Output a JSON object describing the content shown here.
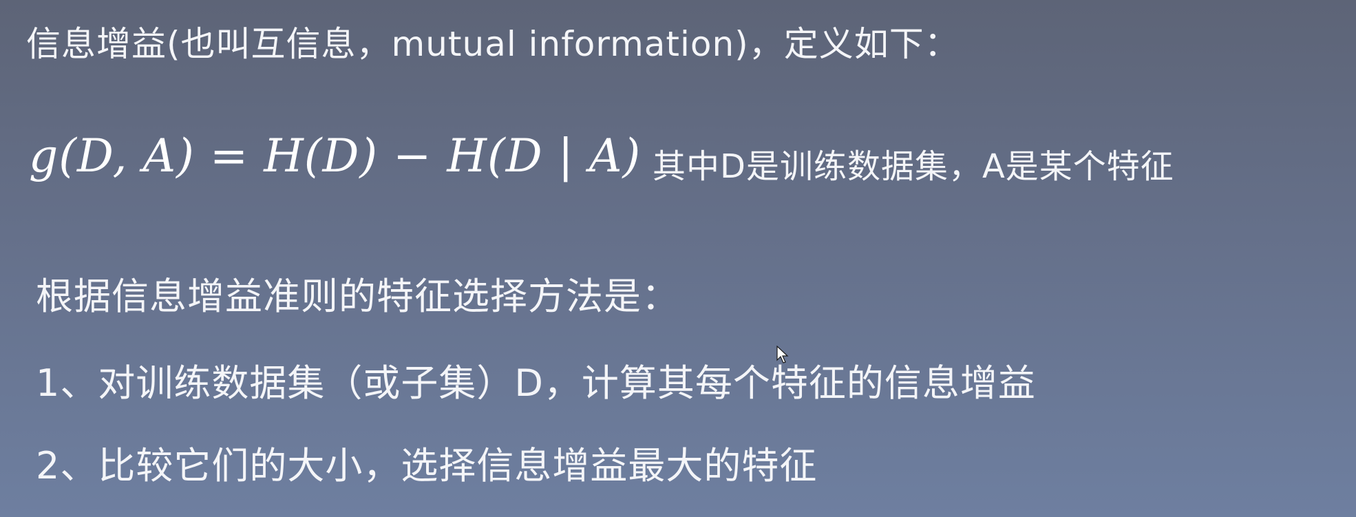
{
  "slide": {
    "intro": "信息增益(也叫互信息，mutual information)，定义如下：",
    "formula": "g(D, A) = H(D) − H(D | A)",
    "formula_note": "其中D是训练数据集，A是某个特征",
    "method_heading": "根据信息增益准则的特征选择方法是：",
    "steps": [
      "1、对训练数据集（或子集）D，计算其每个特征的信息增益",
      "2、比较它们的大小，选择信息增益最大的特征"
    ]
  },
  "colors": {
    "background_top": "#5d6477",
    "background_bottom": "#6e7fa0",
    "text": "#f4f5f8"
  }
}
